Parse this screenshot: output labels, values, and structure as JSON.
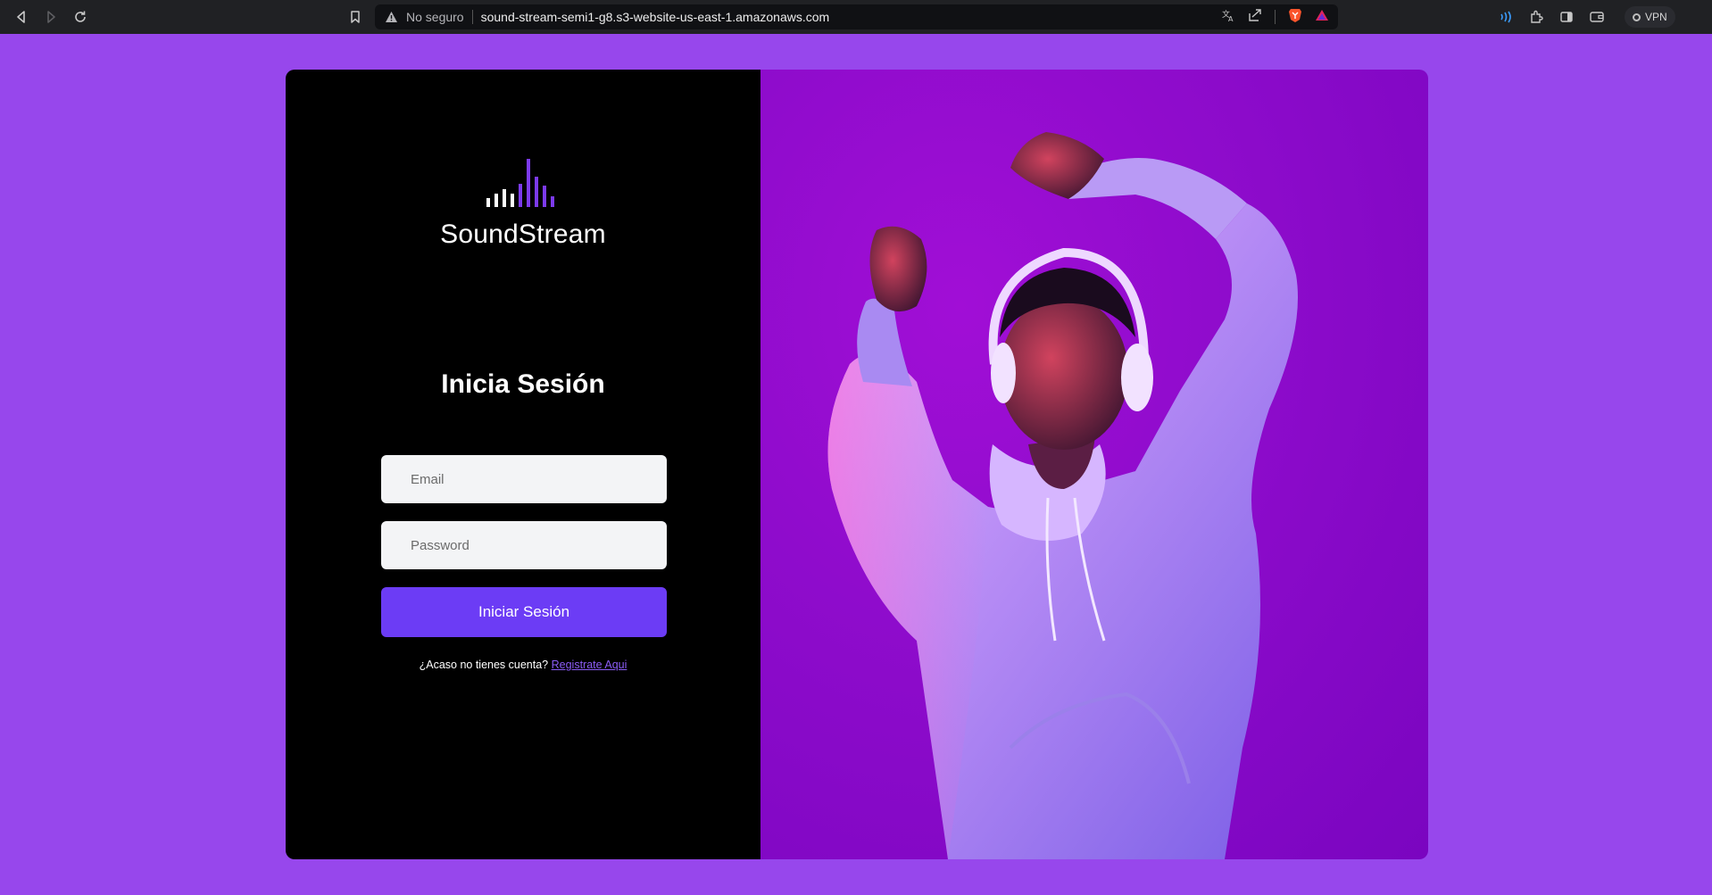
{
  "browser": {
    "security_label": "No seguro",
    "url": "sound-stream-semi1-g8.s3-website-us-east-1.amazonaws.com",
    "vpn_label": "VPN",
    "icons": [
      "back-icon",
      "forward-icon",
      "reload-icon",
      "bookmark-icon",
      "warning-icon",
      "translate-icon",
      "share-icon",
      "brave-shield-icon",
      "brave-rewards-icon",
      "audio-icon",
      "extensions-icon",
      "sidebar-icon",
      "wallet-icon"
    ]
  },
  "login": {
    "brand": "SoundStream",
    "heading": "Inicia Sesión",
    "email_placeholder": "Email",
    "password_placeholder": "Password",
    "submit_label": "Iniciar Sesión",
    "signup_prompt": "¿Acaso no tienes cuenta? ",
    "signup_link": "Registrate Aqui"
  },
  "colors": {
    "page_background": "#9747ec",
    "panel_background": "#000000",
    "accent": "#6c3cf5",
    "link": "#8b5cf6",
    "logo_bars_white": "#ffffff",
    "logo_bars_purple": "#7c3aed"
  }
}
